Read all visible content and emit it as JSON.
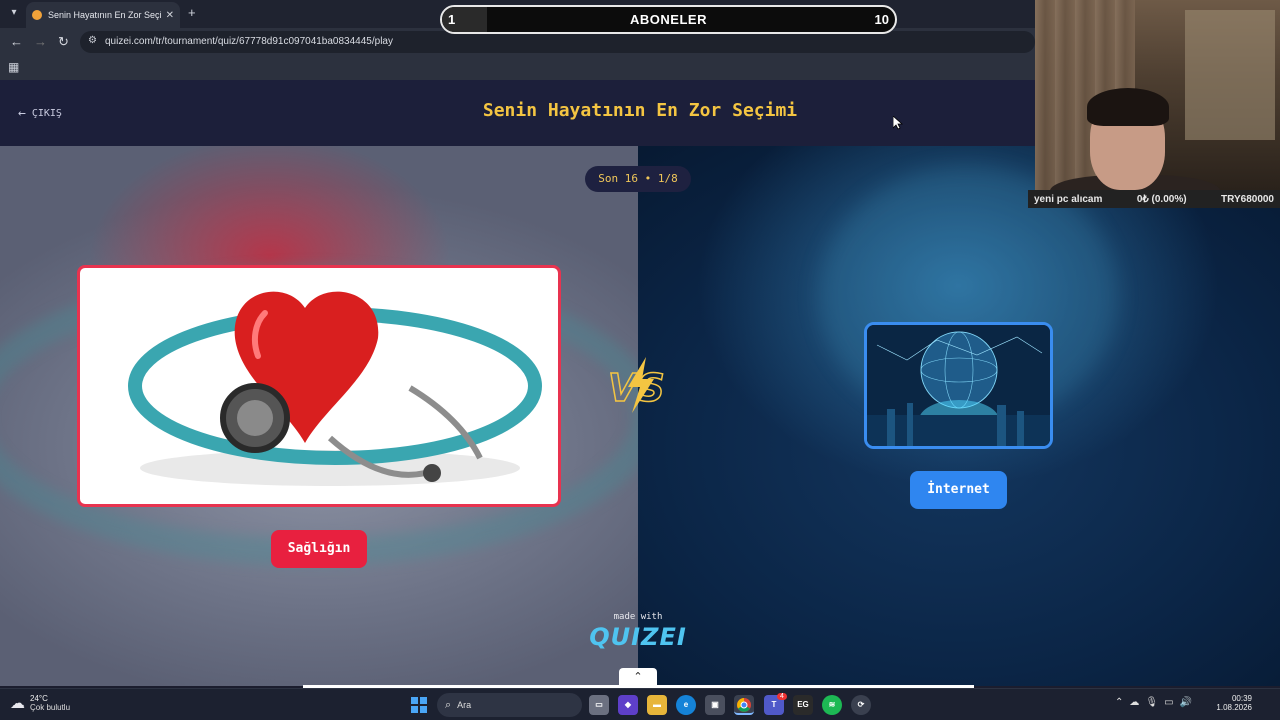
{
  "browser": {
    "tab_title": "Senin Hayatının En Zor Seçimi",
    "url": "quizei.com/tr/tournament/quiz/67778d91c097041ba0834445/play"
  },
  "goal": {
    "title": "ABONELER",
    "current": "1",
    "target": "10",
    "progress": 0.1
  },
  "page": {
    "exit_label": "ÇIKIŞ",
    "title": "Senin Hayatının En Zor Seçimi",
    "round": "Son 16 • 1/8"
  },
  "choices": [
    {
      "label": "Sağlığın",
      "accent": "#e8203f",
      "image": "heart-stethoscope"
    },
    {
      "label": "İnternet",
      "accent": "#2f86f0",
      "image": "digital-globe-city"
    }
  ],
  "branding": {
    "made_with": "made with",
    "brand": "QUIZEI"
  },
  "ticker": {
    "label": "yeni pc alıcam",
    "change": "0₺ (0.00%)",
    "target": "TRY680000"
  },
  "taskbar": {
    "weather_temp": "24°C",
    "weather_desc": "Çok bulutlu",
    "search_placeholder": "Ara",
    "time": "00:39",
    "date": "1.08.2026",
    "teams_badge": "4"
  },
  "colors": {
    "title_gold": "#f4c542",
    "header_bg": "#1c1f3a",
    "brand_cyan": "#4fc4f0"
  }
}
